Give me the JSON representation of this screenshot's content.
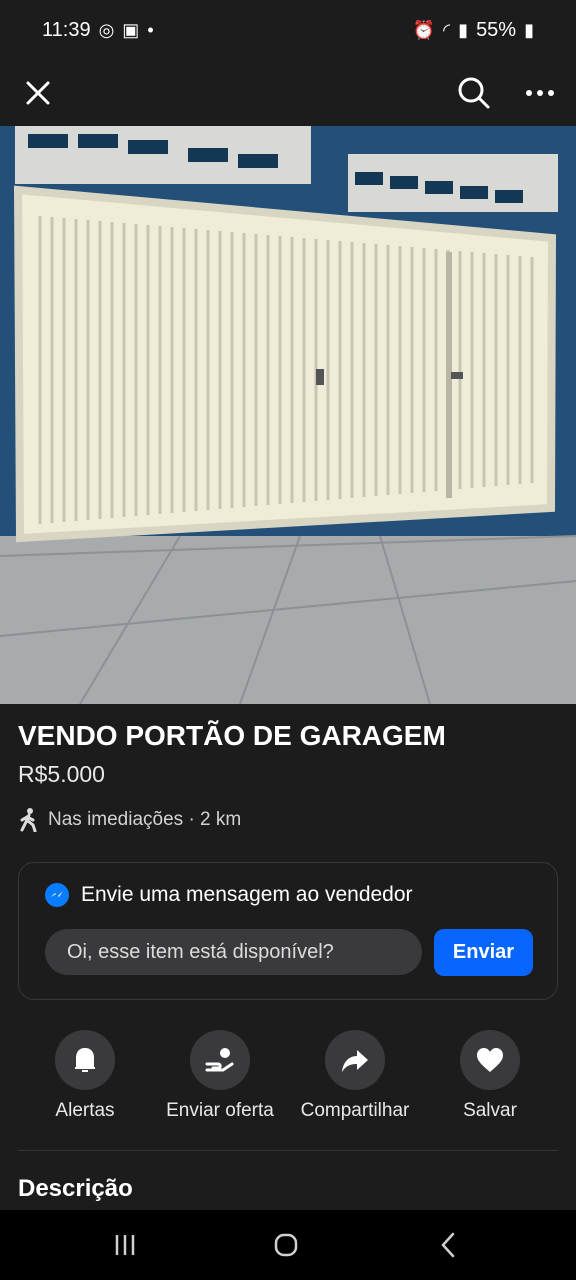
{
  "status_bar": {
    "time": "11:39",
    "battery": "55%",
    "left_icons": [
      "whatsapp-icon",
      "instagram-icon",
      "notification-dot-icon"
    ],
    "right_icons": [
      "alarm-icon",
      "wifi-icon",
      "signal-icon"
    ]
  },
  "app_bar": {
    "close_icon": "close-icon",
    "search_icon": "search-icon",
    "more_icon": "more-icon"
  },
  "listing": {
    "title": "VENDO PORTÃO DE GARAGEM",
    "price": "R$5.000",
    "location": "Nas imediações · 2 km"
  },
  "message": {
    "heading": "Envie uma mensagem ao vendedor",
    "input_value": "Oi, esse item está disponível?",
    "send_label": "Enviar"
  },
  "actions": [
    {
      "label": "Alertas",
      "icon": "bell-icon"
    },
    {
      "label": "Enviar oferta",
      "icon": "offer-icon"
    },
    {
      "label": "Compartilhar",
      "icon": "share-icon"
    },
    {
      "label": "Salvar",
      "icon": "heart-icon"
    }
  ],
  "description": {
    "title": "Descrição"
  },
  "colors": {
    "background": "#1c1c1d",
    "accent": "#0866ff",
    "messenger": "#0a7cff",
    "action_background": "#3a3a3c"
  }
}
